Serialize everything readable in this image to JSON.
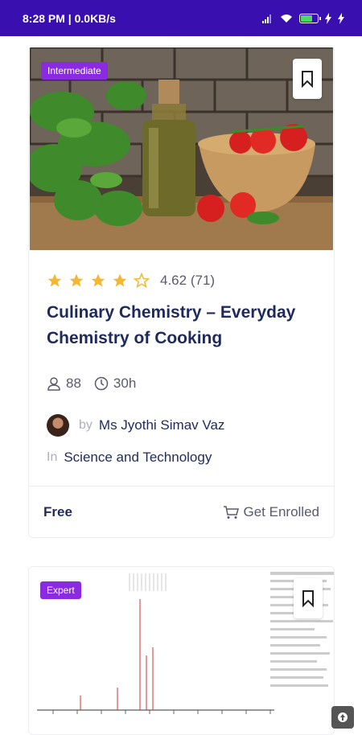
{
  "status_bar": {
    "time_text": "8:28 PM | 0.0KB/s",
    "battery_level": 0.7
  },
  "courses": [
    {
      "level": "Intermediate",
      "rating_value": "4.62",
      "rating_count": "(71)",
      "stars": 4,
      "title": "Culinary Chemistry – Everyday Chemistry of Cooking",
      "students": "88",
      "duration": "30h",
      "by_label": "by",
      "author": "Ms Jyothi Simav Vaz",
      "in_label": "In",
      "category": "Science and Technology",
      "price": "Free",
      "enroll_label": "Get Enrolled"
    },
    {
      "level": "Expert"
    }
  ],
  "colors": {
    "status_bar": "#3a0fb0",
    "badge": "#8a2be2",
    "star": "#f5b731",
    "title": "#1f2a5c"
  },
  "icons": [
    "bookmark-icon",
    "star-icon",
    "user-icon",
    "clock-icon",
    "cart-icon",
    "signal-icon",
    "wifi-icon",
    "battery-icon",
    "bolt-icon",
    "up-arrow-icon"
  ]
}
